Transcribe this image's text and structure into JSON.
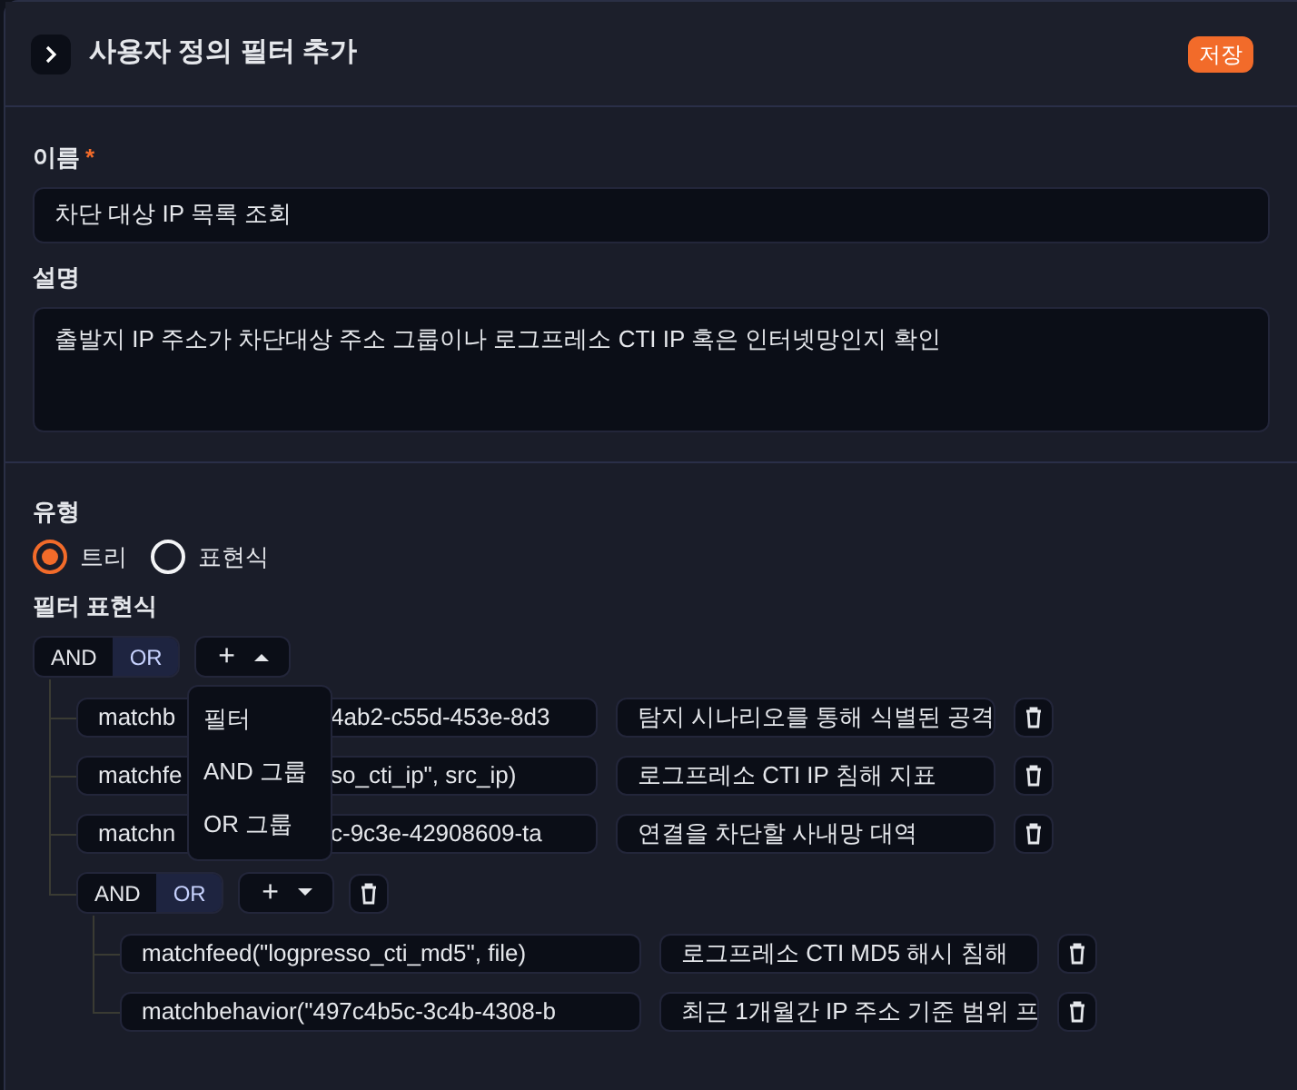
{
  "header": {
    "title": "사용자 정의 필터 추가",
    "save": "저장"
  },
  "name_field": {
    "label": "이름",
    "required_mark": "*",
    "value": "차단 대상 IP 목록 조회"
  },
  "description_field": {
    "label": "설명",
    "value": "출발지 IP 주소가 차단대상 주소 그룹이나 로그프레소 CTI IP 혹은 인터넷망인지 확인"
  },
  "type": {
    "label": "유형",
    "options": [
      {
        "label": "트리",
        "selected": true
      },
      {
        "label": "표현식",
        "selected": false
      }
    ]
  },
  "filter": {
    "label": "필터 표현식",
    "group": {
      "operators": [
        {
          "label": "AND",
          "selected": false
        },
        {
          "label": "OR",
          "selected": true
        }
      ],
      "add_expanded": true,
      "add_label": "+",
      "menu_items": [
        "필터",
        "AND 그룹",
        "OR 그룹"
      ],
      "children": [
        {
          "kind": "filter",
          "expression": "matchb",
          "expression_after": "4ab2-c55d-453e-8d3",
          "description": "탐지 시나리오를 통해 식별된 공격"
        },
        {
          "kind": "filter",
          "expression": "matchfe",
          "expression_after": "so_cti_ip\", src_ip)",
          "description": "로그프레소 CTI IP 침해 지표"
        },
        {
          "kind": "filter",
          "expression": "matchn",
          "expression_after": "c-9c3e-42908609-ta",
          "description": "연결을 차단할 사내망 대역"
        },
        {
          "kind": "group",
          "operators": [
            {
              "label": "AND",
              "selected": false
            },
            {
              "label": "OR",
              "selected": true
            }
          ],
          "add_expanded": false,
          "add_label": "+",
          "children": [
            {
              "kind": "filter",
              "expression": "matchfeed(\"logpresso_cti_md5\", file)",
              "description": "로그프레소 CTI MD5 해시 침해"
            },
            {
              "kind": "filter",
              "expression": "matchbehavior(\"497c4b5c-3c4b-4308-b",
              "description": "최근 1개월간 IP 주소 기준 범위 프"
            }
          ]
        }
      ]
    }
  }
}
